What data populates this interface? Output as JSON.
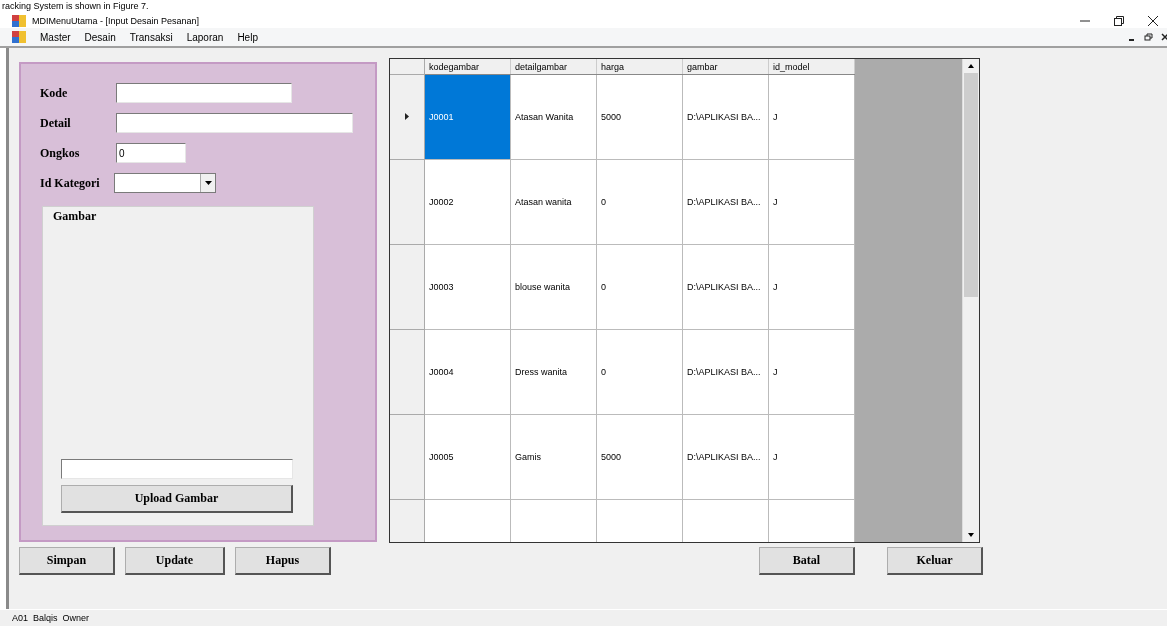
{
  "caption": "racking System is shown in Figure 7.",
  "window": {
    "title": "MDIMenuUtama - [Input Desain Pesanan]"
  },
  "menu": [
    "Master",
    "Desain",
    "Transaksi",
    "Laporan",
    "Help"
  ],
  "form": {
    "fields": [
      {
        "label": "Kode",
        "kind": "text"
      },
      {
        "label": "Detail",
        "kind": "text"
      },
      {
        "label": "Ongkos",
        "kind": "text",
        "value": "0"
      },
      {
        "label": "Id Kategori",
        "kind": "combo"
      }
    ],
    "group": {
      "title": "Gambar",
      "upload_button": "Upload Gambar"
    }
  },
  "table": {
    "columns": [
      "kodegambar",
      "detailgambar",
      "harga",
      "gambar",
      "id_model"
    ],
    "rows": [
      {
        "cells": [
          "J0001",
          "Atasan Wanita",
          "5000",
          "D:\\APLIKASI BA...",
          "J"
        ],
        "selected": true
      },
      {
        "cells": [
          "J0002",
          "Atasan wanita",
          "0",
          "D:\\APLIKASI BA...",
          "J"
        ],
        "selected": false
      },
      {
        "cells": [
          "J0003",
          "blouse wanita",
          "0",
          "D:\\APLIKASI BA...",
          "J"
        ],
        "selected": false
      },
      {
        "cells": [
          "J0004",
          "Dress wanita",
          "0",
          "D:\\APLIKASI BA...",
          "J"
        ],
        "selected": false
      },
      {
        "cells": [
          "J0005",
          "Gamis",
          "5000",
          "D:\\APLIKASI BA...",
          "J"
        ],
        "selected": false
      }
    ]
  },
  "buttons_left": [
    "Simpan",
    "Update",
    "Hapus"
  ],
  "buttons_right": [
    "Batal",
    "Keluar"
  ],
  "status_bar": [
    "A01",
    "Balqis",
    "Owner"
  ]
}
